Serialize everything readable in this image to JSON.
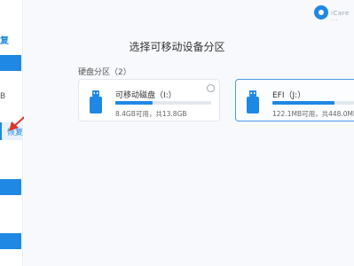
{
  "sidebar": {
    "partial_top_text": "复",
    "partial_mid_text": "B",
    "selected_partial_text": "恢复"
  },
  "window": {
    "title_blur": "iCare ···"
  },
  "main": {
    "heading": "选择可移动设备分区",
    "section_label": "硬盘分区（2）",
    "drives": [
      {
        "name": "可移动磁盘（I:）",
        "size_text": "8.4GB可用，共13.8GB",
        "used_fraction": 0.39,
        "selected": false
      },
      {
        "name": "EFI（J:）",
        "size_text": "122.1MB可用，共448.0MB",
        "used_fraction": 0.73,
        "selected": true
      }
    ]
  },
  "colors": {
    "accent": "#1f88e5",
    "arrow": "#d9372b"
  },
  "icons": [
    "app-logo-icon",
    "usb-drive-icon",
    "radio-unselected-icon",
    "arrow-annotation-icon"
  ]
}
